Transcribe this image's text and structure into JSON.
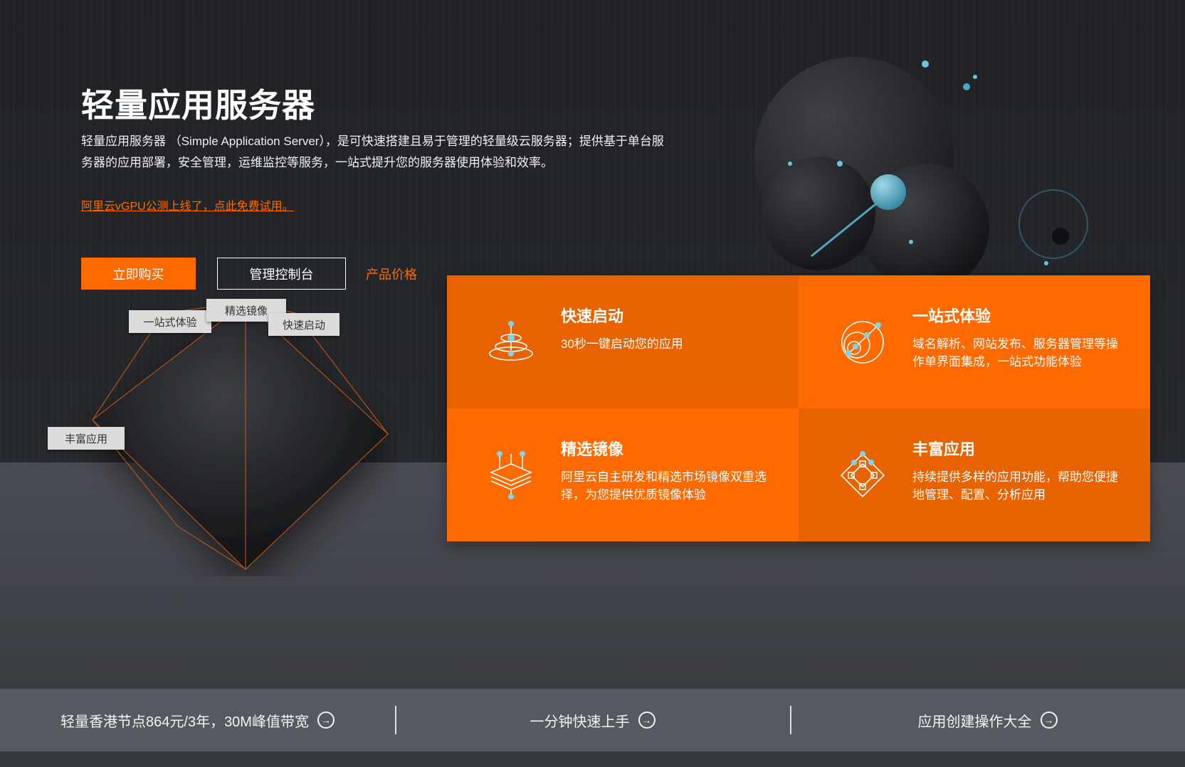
{
  "hero": {
    "title": "轻量应用服务器",
    "description": "轻量应用服务器 （Simple Application Server），是可快速搭建且易于管理的轻量级云服务器；提供基于单台服务器的应用部署，安全管理，运维监控等服务，一站式提升您的服务器使用体验和效率。",
    "promo_link": "阿里云vGPU公测上线了，点此免费试用。",
    "buy_button": "立即购买",
    "console_button": "管理控制台",
    "price_link": "产品价格"
  },
  "diagram_tags": {
    "one_stop": "一站式体验",
    "images": "精选镜像",
    "quick_start": "快速启动",
    "rich_apps": "丰富应用"
  },
  "features": [
    {
      "title": "快速启动",
      "desc": "30秒一键启动您的应用",
      "icon": "stack-layers-icon"
    },
    {
      "title": "一站式体验",
      "desc": "域名解析、网站发布、服务器管理等操作单界面集成，一站式功能体验",
      "icon": "orbit-nodes-icon"
    },
    {
      "title": "精选镜像",
      "desc": "阿里云自主研发和精选市场镜像双重选择，为您提供优质镜像体验",
      "icon": "layered-image-icon"
    },
    {
      "title": "丰富应用",
      "desc": "持续提供多样的应用功能，帮助您便捷地管理、配置、分析应用",
      "icon": "diamond-network-icon"
    }
  ],
  "bottom_bar": [
    {
      "label": "轻量香港节点864元/3年，30M峰值带宽",
      "icon": "arrow-circle-icon"
    },
    {
      "label": "一分钟快速上手",
      "icon": "arrow-circle-icon"
    },
    {
      "label": "应用创建操作大全",
      "icon": "arrow-circle-icon"
    }
  ],
  "colors": {
    "accent": "#ff6a00",
    "accent_dark": "#e86300",
    "hero_bg": "#222428",
    "bar_bg": "#555a61"
  }
}
